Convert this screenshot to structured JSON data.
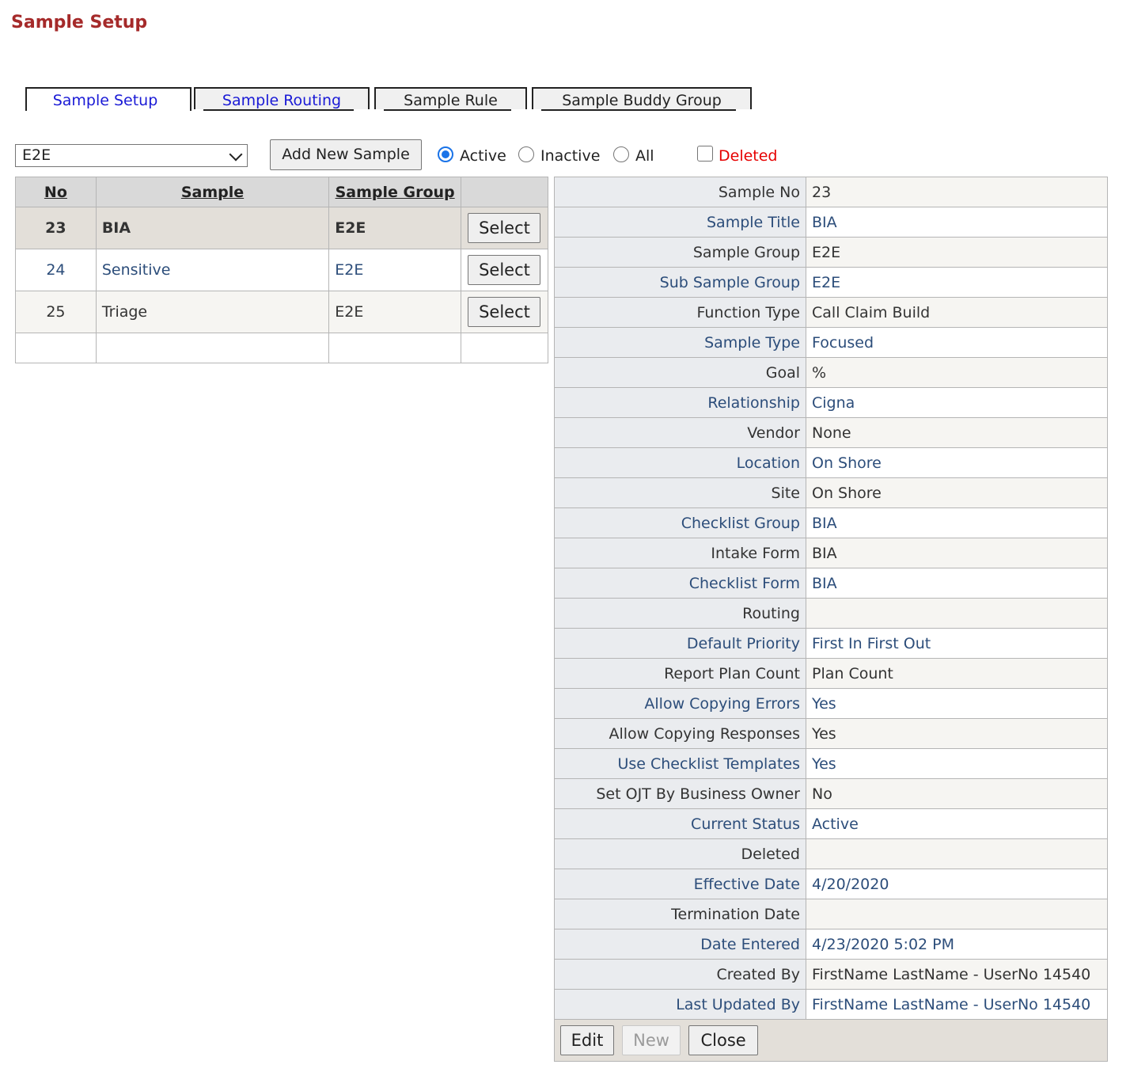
{
  "page": {
    "title": "Sample Setup"
  },
  "tabs": [
    {
      "label": "Sample Setup"
    },
    {
      "label": "Sample Routing"
    },
    {
      "label": "Sample Rule"
    },
    {
      "label": "Sample Buddy Group"
    }
  ],
  "filters": {
    "group_select": "E2E",
    "add_button": "Add New Sample",
    "status_options": [
      "Active",
      "Inactive",
      "All"
    ],
    "status_selected": "Active",
    "deleted_label": "Deleted",
    "deleted_checked": false
  },
  "grid": {
    "headers": [
      "No",
      "Sample",
      "Sample Group",
      ""
    ],
    "select_label": "Select",
    "rows": [
      {
        "no": "23",
        "sample": "BIA",
        "group": "E2E"
      },
      {
        "no": "24",
        "sample": "Sensitive",
        "group": "E2E"
      },
      {
        "no": "25",
        "sample": "Triage",
        "group": "E2E"
      }
    ]
  },
  "details": {
    "rows": [
      {
        "label": "Sample No",
        "value": "23"
      },
      {
        "label": "Sample Title",
        "value": "BIA"
      },
      {
        "label": "Sample Group",
        "value": "E2E"
      },
      {
        "label": "Sub Sample Group",
        "value": "E2E"
      },
      {
        "label": "Function Type",
        "value": "Call Claim Build"
      },
      {
        "label": "Sample Type",
        "value": "Focused"
      },
      {
        "label": "Goal",
        "value": "%"
      },
      {
        "label": "Relationship",
        "value": "Cigna"
      },
      {
        "label": "Vendor",
        "value": "None"
      },
      {
        "label": "Location",
        "value": "On Shore"
      },
      {
        "label": "Site",
        "value": "On Shore"
      },
      {
        "label": "Checklist Group",
        "value": "BIA"
      },
      {
        "label": "Intake Form",
        "value": "BIA"
      },
      {
        "label": "Checklist Form",
        "value": "BIA"
      },
      {
        "label": "Routing",
        "value": ""
      },
      {
        "label": "Default Priority",
        "value": "First In First Out"
      },
      {
        "label": "Report Plan Count",
        "value": "Plan Count"
      },
      {
        "label": "Allow Copying Errors",
        "value": "Yes"
      },
      {
        "label": "Allow Copying Responses",
        "value": "Yes"
      },
      {
        "label": "Use Checklist Templates",
        "value": "Yes"
      },
      {
        "label": "Set OJT By Business Owner",
        "value": "No"
      },
      {
        "label": "Current Status",
        "value": "Active"
      },
      {
        "label": "Deleted",
        "value": ""
      },
      {
        "label": "Effective Date",
        "value": "4/20/2020"
      },
      {
        "label": "Termination Date",
        "value": ""
      },
      {
        "label": "Date Entered",
        "value": "4/23/2020 5:02 PM"
      },
      {
        "label": "Created By",
        "value": "FirstName LastName - UserNo 14540"
      },
      {
        "label": "Last Updated By",
        "value": "FirstName LastName - UserNo 14540"
      }
    ],
    "buttons": {
      "edit": "Edit",
      "new": "New",
      "close": "Close"
    }
  }
}
